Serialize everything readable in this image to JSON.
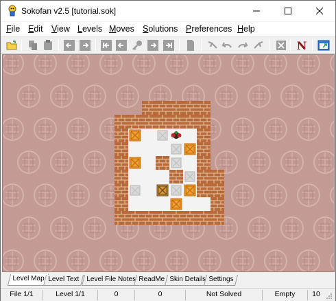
{
  "window": {
    "title": "Sokofan v2.5 [tutorial.sok]"
  },
  "menu": {
    "items": [
      {
        "label": "File",
        "key": "F",
        "rest": "ile"
      },
      {
        "label": "Edit",
        "key": "E",
        "rest": "dit"
      },
      {
        "label": "View",
        "key": "V",
        "rest": "iew"
      },
      {
        "label": "Levels",
        "key": "L",
        "rest": "evels"
      },
      {
        "label": "Moves",
        "key": "M",
        "rest": "oves"
      },
      {
        "label": "Solutions",
        "key": "S",
        "rest": "olutions"
      },
      {
        "label": "Preferences",
        "key": "P",
        "rest": "references"
      },
      {
        "label": "Help",
        "key": "H",
        "rest": "elp"
      }
    ]
  },
  "toolbar": {
    "buttons": [
      {
        "name": "open-icon"
      },
      {
        "name": "copy-icon"
      },
      {
        "name": "paste-icon"
      },
      {
        "name": "previous-level-icon"
      },
      {
        "name": "next-level-icon"
      },
      {
        "name": "first-level-icon"
      },
      {
        "name": "back-icon"
      },
      {
        "name": "key-icon"
      },
      {
        "name": "forward-icon"
      },
      {
        "name": "last-level-icon"
      },
      {
        "name": "document-icon"
      },
      {
        "name": "undo-all-icon"
      },
      {
        "name": "undo-icon"
      },
      {
        "name": "redo-icon"
      },
      {
        "name": "redo-all-icon"
      },
      {
        "name": "delete-icon"
      },
      {
        "name": "n-logo-icon"
      },
      {
        "name": "window-icon"
      }
    ]
  },
  "board": {
    "rows": [
      "  #####",
      "#######",
      "#*     #",
      "#   ### #",
      "#*  $# #",
      "#   $ ##",
      "#.*..$$#",
      "#   $  #",
      "########"
    ]
  },
  "tabs": [
    {
      "label": "Level Map"
    },
    {
      "label": "Level Text"
    },
    {
      "label": "Level File Notes"
    },
    {
      "label": "ReadMe"
    },
    {
      "label": "Skin Details"
    },
    {
      "label": "Settings"
    }
  ],
  "status": {
    "file": "File 1/1",
    "level": "Level 1/1",
    "moves": "0",
    "pushes": "0",
    "solved": "Not Solved",
    "empty": "Empty",
    "extra": "10"
  },
  "colors": {
    "background": "#c39b94",
    "brick": "#b86a3a",
    "floor": "#f3f3f3",
    "crate": "#f0a030"
  }
}
